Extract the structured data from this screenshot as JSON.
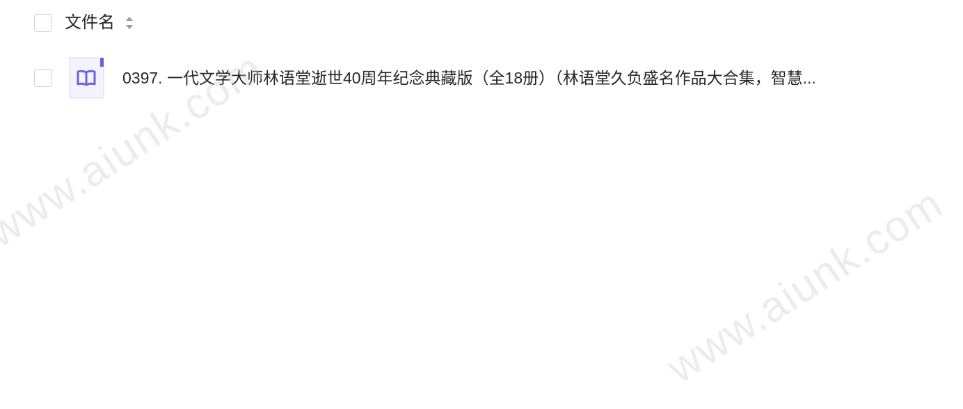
{
  "header": {
    "column_label": "文件名"
  },
  "file": {
    "name": "0397. 一代文学大师林语堂逝世40周年纪念典藏版（全18册）（林语堂久负盛名作品大合集，智慧...",
    "icon": "book-icon"
  },
  "watermark": {
    "text": "www.aiunk.com"
  },
  "colors": {
    "text": "#25262b",
    "checkbox_border": "#cfd1d6",
    "icon_accent": "#6b63d9",
    "icon_bg": "#f3f2fd"
  }
}
